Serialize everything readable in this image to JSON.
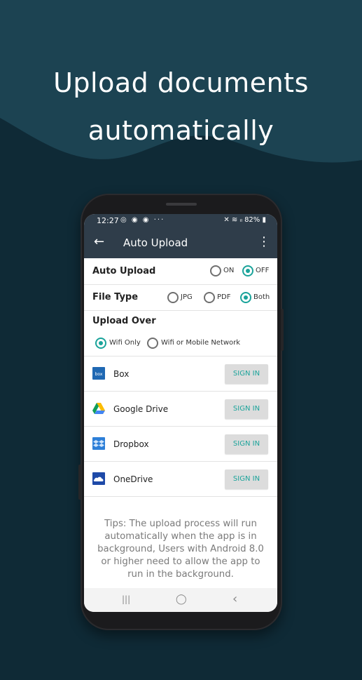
{
  "headline": {
    "line1": "Upload documents",
    "line2": "automatically"
  },
  "status_bar": {
    "time": "12:27",
    "icons_left": "◎ ◉ ◉ ···",
    "battery": "82%",
    "icons_right": "✕ ≋ ᵢₗ"
  },
  "app_bar": {
    "back_icon": "←",
    "title": "Auto Upload",
    "menu_icon": "⋮"
  },
  "auto_upload": {
    "label": "Auto Upload",
    "options": [
      "ON",
      "OFF"
    ],
    "selected": "OFF"
  },
  "file_type": {
    "label": "File Type",
    "options": [
      "JPG",
      "PDF",
      "Both"
    ],
    "selected": "Both"
  },
  "upload_over": {
    "label": "Upload Over",
    "options": [
      "Wifi Only",
      "Wifi or Mobile Network"
    ],
    "selected": "Wifi Only"
  },
  "services": [
    {
      "name": "Box",
      "button": "SIGN IN",
      "logo_text": "box"
    },
    {
      "name": "Google Drive",
      "button": "SIGN IN"
    },
    {
      "name": "Dropbox",
      "button": "SIGN IN"
    },
    {
      "name": "OneDrive",
      "button": "SIGN IN"
    }
  ],
  "tips": "Tips: The upload process will run automatically when the app is in background, Users with Android 8.0 or higher need to allow the app to run in the background.",
  "nav_bar": {
    "recents": "|||",
    "home": "◯",
    "back": "‹"
  },
  "colors": {
    "accent": "#1aa39a",
    "appbar": "#2f3d4a",
    "background": "#0f2a36",
    "wave": "#1c4352"
  }
}
